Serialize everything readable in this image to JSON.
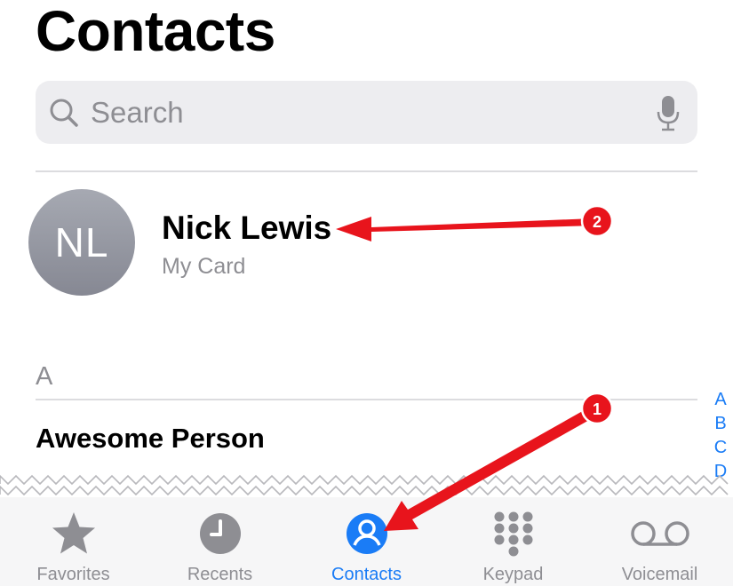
{
  "header": {
    "title": "Contacts"
  },
  "search": {
    "placeholder": "Search",
    "icon": "search-icon",
    "mic_icon": "microphone-icon"
  },
  "my_card": {
    "initials": "NL",
    "name": "Nick Lewis",
    "subtitle": "My Card"
  },
  "sections": [
    {
      "letter": "A",
      "contacts": [
        "Awesome Person"
      ]
    }
  ],
  "index_letters": [
    "A",
    "B",
    "C",
    "D"
  ],
  "tabbar": {
    "tabs": [
      {
        "label": "Favorites",
        "icon": "star-icon",
        "active": false
      },
      {
        "label": "Recents",
        "icon": "clock-icon",
        "active": false
      },
      {
        "label": "Contacts",
        "icon": "person-circle-icon",
        "active": true
      },
      {
        "label": "Keypad",
        "icon": "keypad-icon",
        "active": false
      },
      {
        "label": "Voicemail",
        "icon": "voicemail-icon",
        "active": false
      }
    ]
  },
  "annotations": [
    {
      "number": "1"
    },
    {
      "number": "2"
    }
  ],
  "colors": {
    "accent": "#1a7cf6",
    "annotation": "#e8141c",
    "secondary_text": "#8e8e93"
  }
}
